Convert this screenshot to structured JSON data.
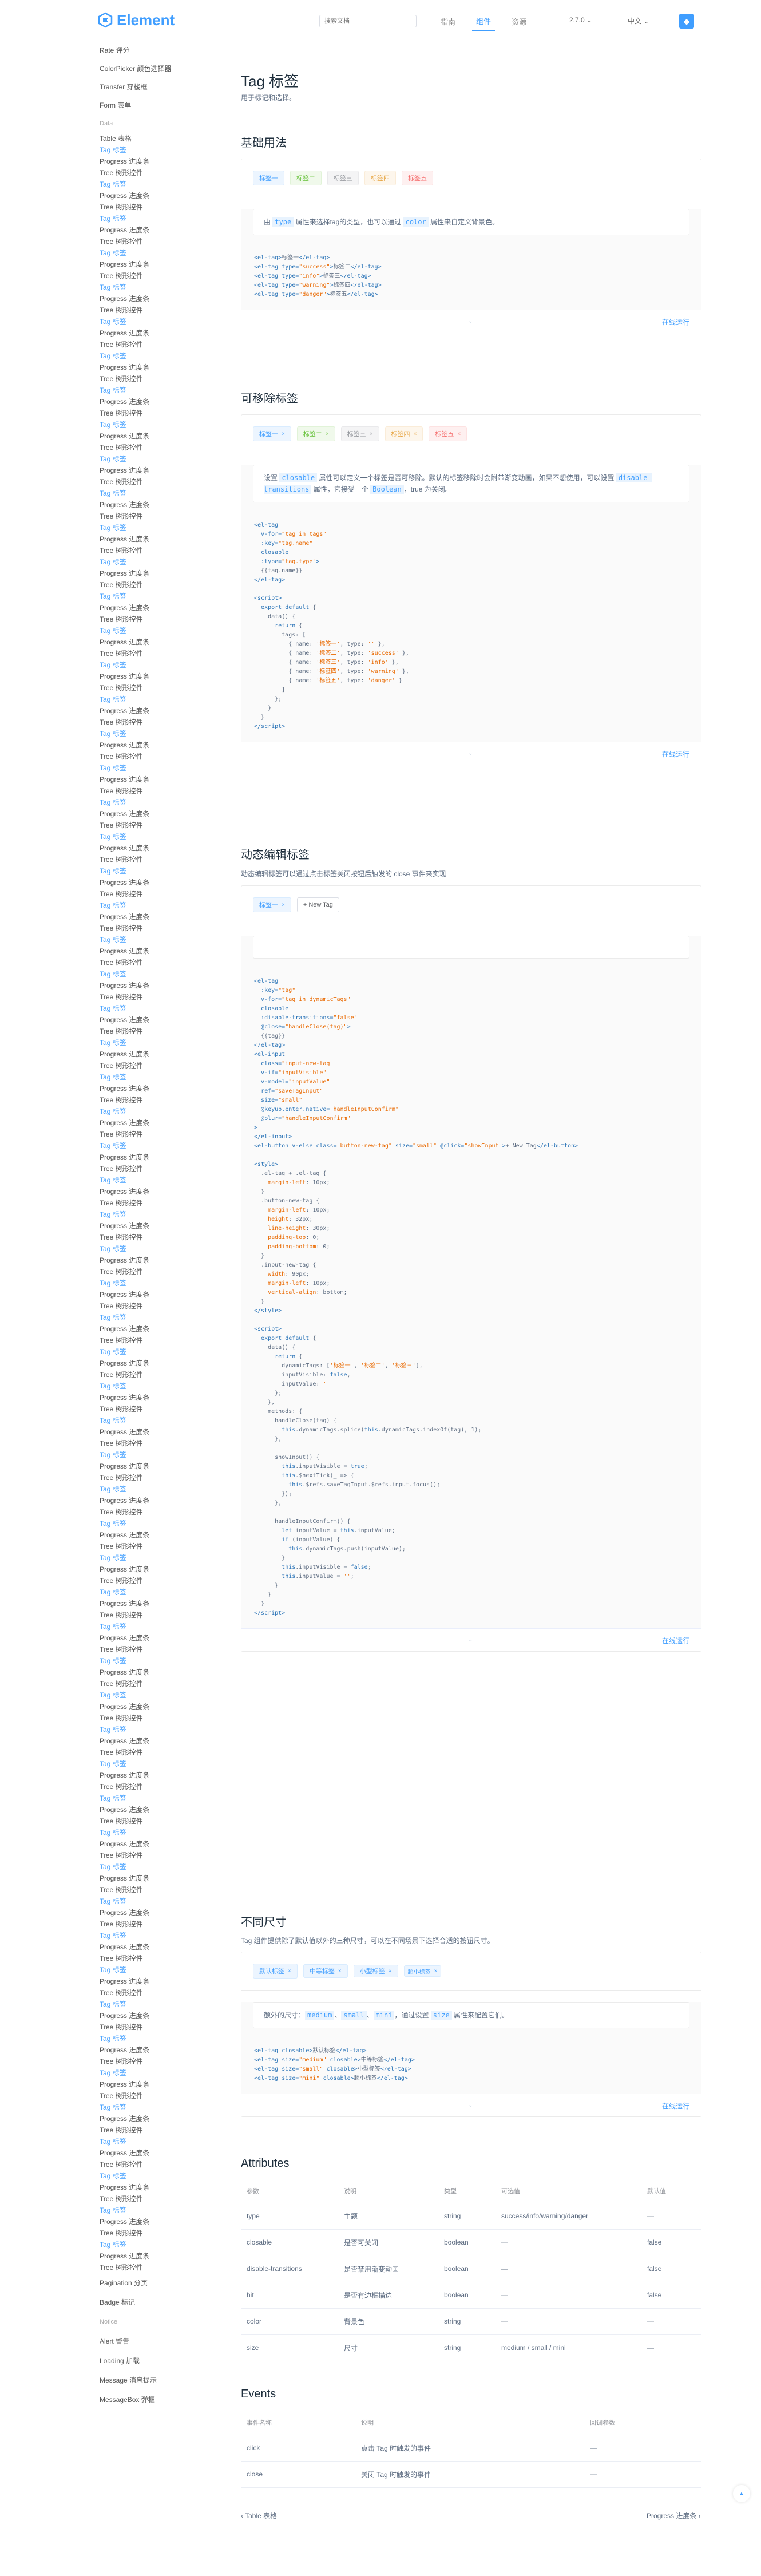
{
  "header": {
    "logo": "Element",
    "search_placeholder": "搜索文档",
    "nav": [
      "指南",
      "组件",
      "资源"
    ],
    "active_nav": "组件",
    "version": "2.7.0 ⌄",
    "lang": "中文 ⌄",
    "gh": "◆"
  },
  "sidebar": [
    "Rate 评分",
    "ColorPicker 颜色选择器",
    "Transfer 穿梭框",
    "Form 表单",
    "Data",
    "Table 表格",
    "Tag 标签",
    "Progress 进度条",
    "Tree 树形控件",
    "Tag 标签",
    "Progress 进度条",
    "Tree 树形控件",
    "Tag 标签",
    "Progress 进度条",
    "Tree 树形控件",
    "Tag 标签",
    "Progress 进度条",
    "Tree 树形控件",
    "Tag 标签",
    "Progress 进度条",
    "Tree 树形控件",
    "Tag 标签",
    "Progress 进度条",
    "Tree 树形控件",
    "Tag 标签",
    "Progress 进度条",
    "Tree 树形控件",
    "Tag 标签",
    "Progress 进度条",
    "Tree 树形控件",
    "Tag 标签",
    "Progress 进度条",
    "Tree 树形控件",
    "Tag 标签",
    "Progress 进度条",
    "Tree 树形控件",
    "Tag 标签",
    "Progress 进度条",
    "Tree 树形控件",
    "Tag 标签",
    "Progress 进度条",
    "Tree 树形控件",
    "Tag 标签",
    "Progress 进度条",
    "Tree 树形控件",
    "Tag 标签",
    "Progress 进度条",
    "Tree 树形控件",
    "Tag 标签",
    "Progress 进度条",
    "Tree 树形控件",
    "Tag 标签",
    "Progress 进度条",
    "Tree 树形控件",
    "Tag 标签",
    "Progress 进度条",
    "Tree 树形控件",
    "Tag 标签",
    "Progress 进度条",
    "Tree 树形控件",
    "Tag 标签",
    "Progress 进度条",
    "Tree 树形控件",
    "Tag 标签",
    "Progress 进度条",
    "Tree 树形控件",
    "Tag 标签",
    "Progress 进度条",
    "Tree 树形控件",
    "Tag 标签",
    "Progress 进度条",
    "Tree 树形控件",
    "Tag 标签",
    "Progress 进度条",
    "Tree 树形控件",
    "Tag 标签",
    "Progress 进度条",
    "Tree 树形控件",
    "Tag 标签",
    "Progress 进度条",
    "Tree 树形控件",
    "Tag 标签",
    "Progress 进度条",
    "Tree 树形控件",
    "Tag 标签",
    "Progress 进度条",
    "Tree 树形控件",
    "Tag 标签",
    "Progress 进度条",
    "Tree 树形控件",
    "Tag 标签",
    "Progress 进度条",
    "Tree 树形控件",
    "Tag 标签",
    "Progress 进度条",
    "Tree 树形控件",
    "Tag 标签",
    "Progress 进度条",
    "Tree 树形控件",
    "Tag 标签",
    "Progress 进度条",
    "Tree 树形控件",
    "Tag 标签",
    "Progress 进度条",
    "Tree 树形控件",
    "Tag 标签",
    "Progress 进度条",
    "Tree 树形控件",
    "Tag 标签",
    "Progress 进度条",
    "Tree 树形控件",
    "Tag 标签",
    "Progress 进度条",
    "Tree 树形控件",
    "Tag 标签",
    "Progress 进度条",
    "Tree 树形控件",
    "Tag 标签",
    "Progress 进度条",
    "Tree 树形控件",
    "Tag 标签",
    "Progress 进度条",
    "Tree 树形控件",
    "Tag 标签",
    "Progress 进度条",
    "Tree 树形控件",
    "Tag 标签",
    "Progress 进度条",
    "Tree 树形控件",
    "Tag 标签",
    "Progress 进度条",
    "Tree 树形控件",
    "Tag 标签",
    "Progress 进度条",
    "Tree 树形控件",
    "Tag 标签",
    "Progress 进度条",
    "Tree 树形控件",
    "Tag 标签",
    "Progress 进度条",
    "Tree 树形控件",
    "Tag 标签",
    "Progress 进度条",
    "Tree 树形控件",
    "Tag 标签",
    "Progress 进度条",
    "Tree 树形控件",
    "Tag 标签",
    "Progress 进度条",
    "Tree 树形控件",
    "Tag 标签",
    "Progress 进度条",
    "Tree 树形控件",
    "Tag 标签",
    "Progress 进度条",
    "Tree 树形控件",
    "Tag 标签",
    "Progress 进度条",
    "Tree 树形控件",
    "Tag 标签",
    "Progress 进度条",
    "Tree 树形控件",
    "Tag 标签",
    "Progress 进度条",
    "Tree 树形控件",
    "Tag 标签",
    "Progress 进度条",
    "Tree 树形控件",
    "Tag 标签",
    "Progress 进度条",
    "Tree 树形控件",
    "Tag 标签",
    "Progress 进度条",
    "Tree 树形控件",
    "Tag 标签",
    "Progress 进度条",
    "Tree 树形控件",
    "Tag 标签",
    "Progress 进度条",
    "Tree 树形控件",
    "Tag 标签",
    "Progress 进度条",
    "Tree 树形控件",
    "Tag 标签",
    "Progress 进度条",
    "Tree 树形控件",
    "Tag 标签",
    "Progress 进度条",
    "Tree 树形控件",
    "Tag 标签",
    "Progress 进度条",
    "Tree 树形控件",
    "Pagination 分页",
    "Badge 标记",
    "Notice",
    "Alert 警告",
    "Loading 加载",
    "Message 消息提示",
    "MessageBox 弹框"
  ],
  "page": {
    "title": "Tag 标签",
    "subtitle": "用于标记和选择。"
  },
  "s1": {
    "title": "基础用法",
    "tags": [
      "标签一",
      "标签二",
      "标签三",
      "标签四",
      "标签五"
    ],
    "desc": [
      "由 ",
      "type",
      " 属性来选择tag的类型，也可以通过 ",
      "color",
      " 属性来自定义背景色。"
    ],
    "run": "在线运行",
    "arrow": "⌄"
  },
  "s2": {
    "title": "可移除标签",
    "tags": [
      "标签一",
      "标签二",
      "标签三",
      "标签四",
      "标签五"
    ],
    "x": "×",
    "desc": [
      "设置 ",
      "closable",
      " 属性可以定义一个标签是否可移除。默认的标签移除时会附带渐变动画，如果不想使用，可以设置 ",
      "disable-transitions",
      " 属性，它接受一个 ",
      "Boolean",
      "，true 为关闭。"
    ],
    "run": "在线运行",
    "arrow": "⌄"
  },
  "s3": {
    "title": "动态编辑标签",
    "sub": "动态编辑标签可以通过点击标签关闭按钮后触发的 close 事件来实现",
    "tag": "标签一",
    "btn": "+ New Tag",
    "run": "在线运行",
    "arrow": "⌄"
  },
  "s4": {
    "title": "不同尺寸",
    "sub": "Tag 组件提供除了默认值以外的三种尺寸，可以在不同场景下选择合适的按钮尺寸。",
    "tags": [
      "默认标签",
      "中等标签",
      "小型标签",
      "超小标签"
    ],
    "desc": [
      "额外的尺寸：",
      "medium",
      "、",
      "small",
      "、",
      "mini",
      "，通过设置 ",
      "size",
      " 属性来配置它们。"
    ],
    "run": "在线运行",
    "arrow": "⌄"
  },
  "attrs": {
    "title": "Attributes",
    "head": [
      "参数",
      "说明",
      "类型",
      "可选值",
      "默认值"
    ],
    "rows": [
      [
        "type",
        "主题",
        "string",
        "success/info/warning/danger",
        "—"
      ],
      [
        "closable",
        "是否可关闭",
        "boolean",
        "—",
        "false"
      ],
      [
        "disable-transitions",
        "是否禁用渐变动画",
        "boolean",
        "—",
        "false"
      ],
      [
        "hit",
        "是否有边框描边",
        "boolean",
        "—",
        "false"
      ],
      [
        "color",
        "背景色",
        "string",
        "—",
        "—"
      ],
      [
        "size",
        "尺寸",
        "string",
        "medium / small / mini",
        "—"
      ]
    ]
  },
  "events": {
    "title": "Events",
    "head": [
      "事件名称",
      "说明",
      "回调参数"
    ],
    "rows": [
      [
        "click",
        "点击 Tag 时触发的事件",
        "—"
      ],
      [
        "close",
        "关闭 Tag 时触发的事件",
        "—"
      ]
    ]
  },
  "pager": {
    "prev": "‹ Table 表格",
    "next": "Progress 进度条 ›"
  },
  "totop": "▲"
}
